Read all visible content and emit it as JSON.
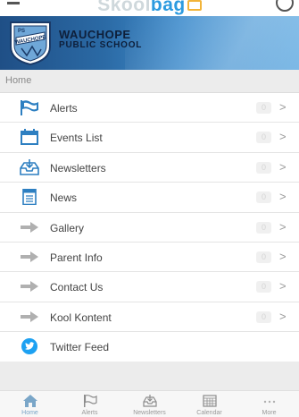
{
  "header": {
    "brand_part1": "Skool",
    "brand_part2": "bag",
    "menu_icon": "menu-icon",
    "settings_icon": "settings-icon"
  },
  "banner": {
    "crest_text": "WAUCHOPE",
    "crest_initials": "PS",
    "school_name_line1": "WAUCHOPE",
    "school_name_line2": "PUBLIC SCHOOL"
  },
  "breadcrumb": {
    "label": "Home"
  },
  "menu": {
    "items": [
      {
        "label": "Alerts",
        "icon": "flag-icon",
        "badge": "0"
      },
      {
        "label": "Events List",
        "icon": "calendar-icon",
        "badge": "0"
      },
      {
        "label": "Newsletters",
        "icon": "inbox-icon",
        "badge": "0"
      },
      {
        "label": "News",
        "icon": "document-icon",
        "badge": "0"
      },
      {
        "label": "Gallery",
        "icon": "arrow-right-icon",
        "badge": "0"
      },
      {
        "label": "Parent Info",
        "icon": "arrow-right-icon",
        "badge": "0"
      },
      {
        "label": "Contact Us",
        "icon": "arrow-right-icon",
        "badge": "0"
      },
      {
        "label": "Kool Kontent",
        "icon": "arrow-right-icon",
        "badge": "0"
      },
      {
        "label": "Twitter Feed",
        "icon": "twitter-icon",
        "badge": ""
      }
    ],
    "chevron": ">"
  },
  "tabbar": {
    "tabs": [
      {
        "label": "Home",
        "icon": "home-icon",
        "active": true
      },
      {
        "label": "Alerts",
        "icon": "flag-icon",
        "active": false
      },
      {
        "label": "Newsletters",
        "icon": "inbox-icon",
        "active": false
      },
      {
        "label": "Calendar",
        "icon": "calendar-grid-icon",
        "active": false
      },
      {
        "label": "More",
        "icon": "more-dots-icon",
        "active": false
      }
    ]
  },
  "colors": {
    "accent": "#2d9be0",
    "banner_dark": "#1f4f86",
    "banner_light": "#6cb0e3",
    "icon_blue": "#2d7fc1",
    "arrow_gray": "#b0b0b0"
  }
}
